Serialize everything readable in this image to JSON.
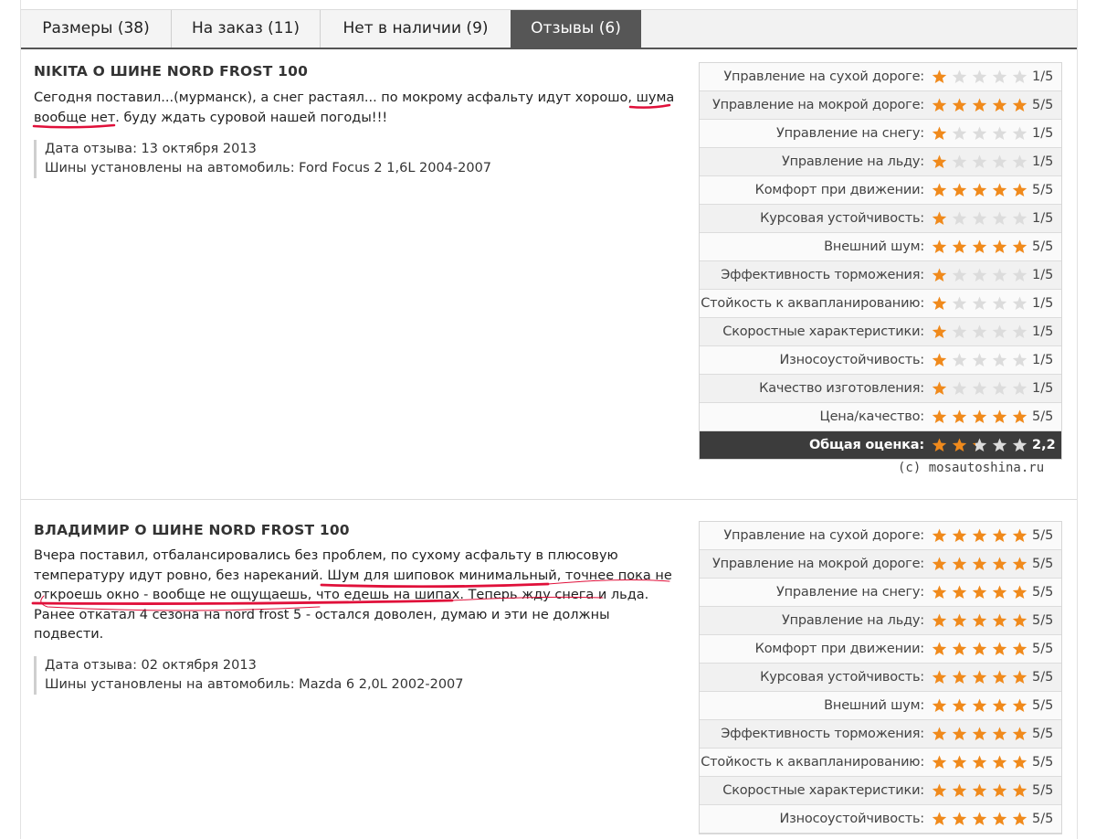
{
  "tabs": [
    {
      "label": "Размеры (38)",
      "active": false
    },
    {
      "label": "На заказ (11)",
      "active": false
    },
    {
      "label": "Нет в наличии (9)",
      "active": false
    },
    {
      "label": "Отзывы (6)",
      "active": true
    }
  ],
  "colors": {
    "star_full": "#f08a1c",
    "star_empty": "#dcdcdc",
    "tab_active": "#565656",
    "annotation": "#e0103a"
  },
  "reviews": [
    {
      "title": "NIKITA О ШИНЕ NORD FROST 100",
      "text": "Сегодня поставил...(мурманск), а снег растаял... по мокрому асфальту идут хорошо, шума вообще нет. буду ждать суровой нашей погоды!!!",
      "date": "Дата отзыва: 13 октября 2013",
      "car": "Шины установлены на автомобиль: Ford Focus 2  1,6L  2004-2007",
      "ratings": [
        {
          "label": "Управление на сухой дороге:",
          "stars": 1,
          "score": "1/5"
        },
        {
          "label": "Управление на мокрой дороге:",
          "stars": 5,
          "score": "5/5"
        },
        {
          "label": "Управление на снегу:",
          "stars": 1,
          "score": "1/5"
        },
        {
          "label": "Управление на льду:",
          "stars": 1,
          "score": "1/5"
        },
        {
          "label": "Комфорт при движении:",
          "stars": 5,
          "score": "5/5"
        },
        {
          "label": "Курсовая устойчивость:",
          "stars": 1,
          "score": "1/5"
        },
        {
          "label": "Внешний шум:",
          "stars": 5,
          "score": "5/5"
        },
        {
          "label": "Эффективность торможения:",
          "stars": 1,
          "score": "1/5"
        },
        {
          "label": "Стойкость к аквапланированию:",
          "stars": 1,
          "score": "1/5"
        },
        {
          "label": "Скоростные характеристики:",
          "stars": 1,
          "score": "1/5"
        },
        {
          "label": "Износоустойчивость:",
          "stars": 1,
          "score": "1/5"
        },
        {
          "label": "Качество изготовления:",
          "stars": 1,
          "score": "1/5"
        },
        {
          "label": "Цена/качество:",
          "stars": 5,
          "score": "5/5"
        }
      ],
      "overall": {
        "label": "Общая оценка:",
        "stars": 2.2,
        "score": "2,2"
      },
      "credit": "(c) mosautoshina.ru"
    },
    {
      "title": "ВЛАДИМИР О ШИНЕ NORD FROST 100",
      "text": "Вчера поставил, отбалансировались без проблем, по сухому асфальту в плюсовую температуру идут ровно, без нареканий. Шум для шиповок минимальный, точнее пока не откроешь окно - вообще не ощущаешь, что едешь на шипах. Теперь жду снега и льда. Ранее откатал 4 сезона на nord frost 5 - остался доволен, думаю и эти не должны подвести.",
      "date": "Дата отзыва: 02 октября 2013",
      "car": "Шины установлены на автомобиль: Mazda 6  2,0L  2002-2007",
      "ratings": [
        {
          "label": "Управление на сухой дороге:",
          "stars": 5,
          "score": "5/5"
        },
        {
          "label": "Управление на мокрой дороге:",
          "stars": 5,
          "score": "5/5"
        },
        {
          "label": "Управление на снегу:",
          "stars": 5,
          "score": "5/5"
        },
        {
          "label": "Управление на льду:",
          "stars": 5,
          "score": "5/5"
        },
        {
          "label": "Комфорт при движении:",
          "stars": 5,
          "score": "5/5"
        },
        {
          "label": "Курсовая устойчивость:",
          "stars": 5,
          "score": "5/5"
        },
        {
          "label": "Внешний шум:",
          "stars": 5,
          "score": "5/5"
        },
        {
          "label": "Эффективность торможения:",
          "stars": 5,
          "score": "5/5"
        },
        {
          "label": "Стойкость к аквапланированию:",
          "stars": 5,
          "score": "5/5"
        },
        {
          "label": "Скоростные характеристики:",
          "stars": 5,
          "score": "5/5"
        },
        {
          "label": "Износоустойчивость:",
          "stars": 5,
          "score": "5/5"
        }
      ]
    }
  ]
}
